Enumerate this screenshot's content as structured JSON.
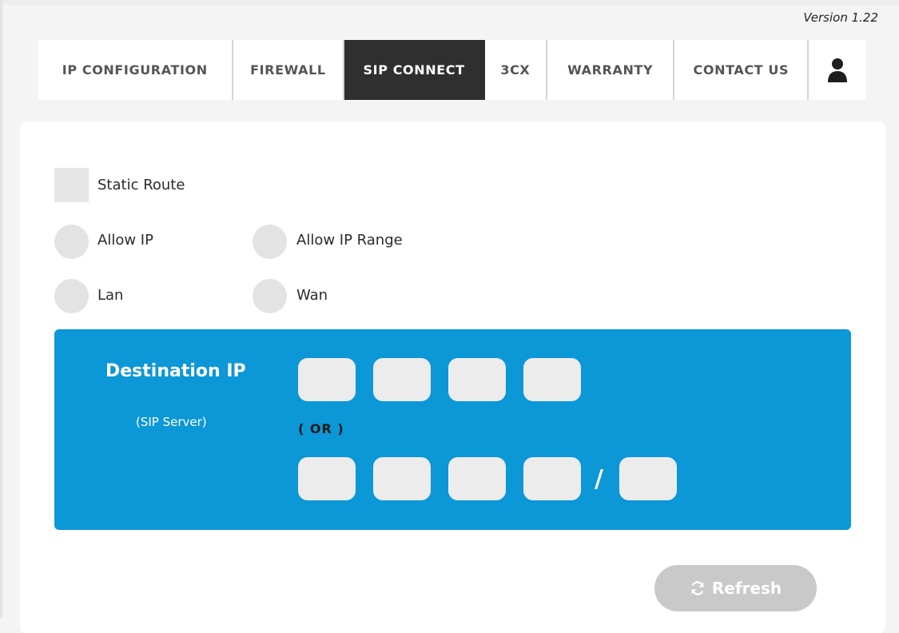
{
  "header": {
    "version": "Version 1.22"
  },
  "nav": {
    "tabs": [
      {
        "label": "IP CONFIGURATION"
      },
      {
        "label": "FIREWALL"
      },
      {
        "label": "SIP CONNECT"
      },
      {
        "label": "3CX"
      },
      {
        "label": "WARRANTY"
      },
      {
        "label": "CONTACT US"
      }
    ],
    "active_tab": "SIP CONNECT",
    "user_icon": "user-icon"
  },
  "form": {
    "static_route_label": "Static Route",
    "allow_ip_label": "Allow IP",
    "allow_ip_range_label": "Allow IP Range",
    "lan_label": "Lan",
    "wan_label": "Wan"
  },
  "destination": {
    "title": "Destination IP",
    "subtitle": "(SIP Server)",
    "or_text": "( OR )",
    "slash": "/",
    "ip_octets": [
      "",
      "",
      "",
      ""
    ],
    "range_octets": [
      "",
      "",
      "",
      ""
    ],
    "cidr": ""
  },
  "actions": {
    "refresh_label": "Refresh",
    "refresh_icon": "refresh-icon"
  },
  "colors": {
    "accent": "#0c97d6",
    "active_tab": "#2f2f2f",
    "input_bg": "#ececec",
    "button_disabled": "#c9c9c9"
  }
}
